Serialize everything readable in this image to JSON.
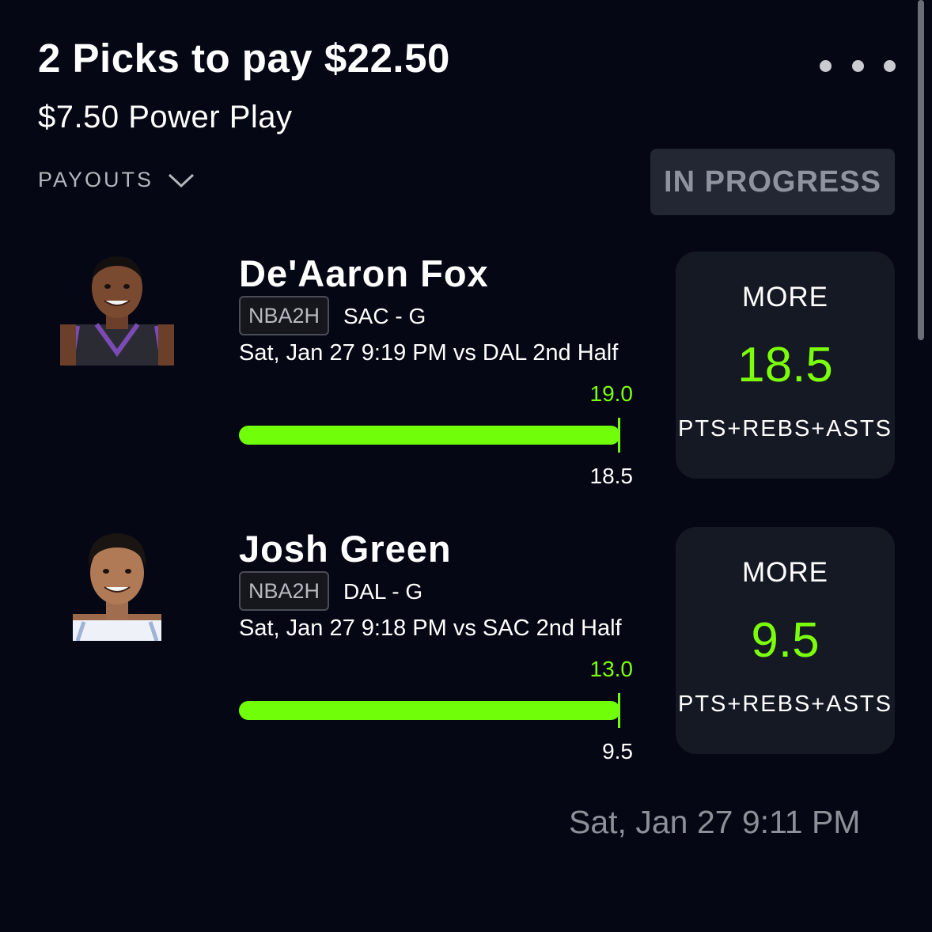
{
  "header": {
    "title": "2 Picks to pay $22.50",
    "subtitle": "$7.50 Power Play",
    "payouts_label": "PAYOUTS",
    "status": "IN PROGRESS"
  },
  "picks": [
    {
      "player_name": "De'Aaron Fox",
      "league": "NBA2H",
      "team_position": "SAC - G",
      "game_info": "Sat, Jan 27 9:19 PM  vs DAL 2nd Half",
      "current_value": "19.0",
      "line_value": "18.5",
      "progress_fraction": 1.0,
      "direction": "MORE",
      "line": "18.5",
      "stat": "PTS+REBS+ASTS",
      "jersey_color": "#2b2b33",
      "jersey_trim": "#7a4bb4"
    },
    {
      "player_name": "Josh Green",
      "league": "NBA2H",
      "team_position": "DAL - G",
      "game_info": "Sat, Jan 27 9:18 PM  vs SAC 2nd Half",
      "current_value": "13.0",
      "line_value": "9.5",
      "progress_fraction": 1.0,
      "direction": "MORE",
      "line": "9.5",
      "stat": "PTS+REBS+ASTS",
      "jersey_color": "#eef2f8",
      "jersey_trim": "#9fb3d6"
    }
  ],
  "footer": {
    "created_at": "Sat, Jan 27 9:11 PM"
  },
  "colors": {
    "background": "#050814",
    "accent_green": "#70ff08",
    "card": "#151924"
  }
}
